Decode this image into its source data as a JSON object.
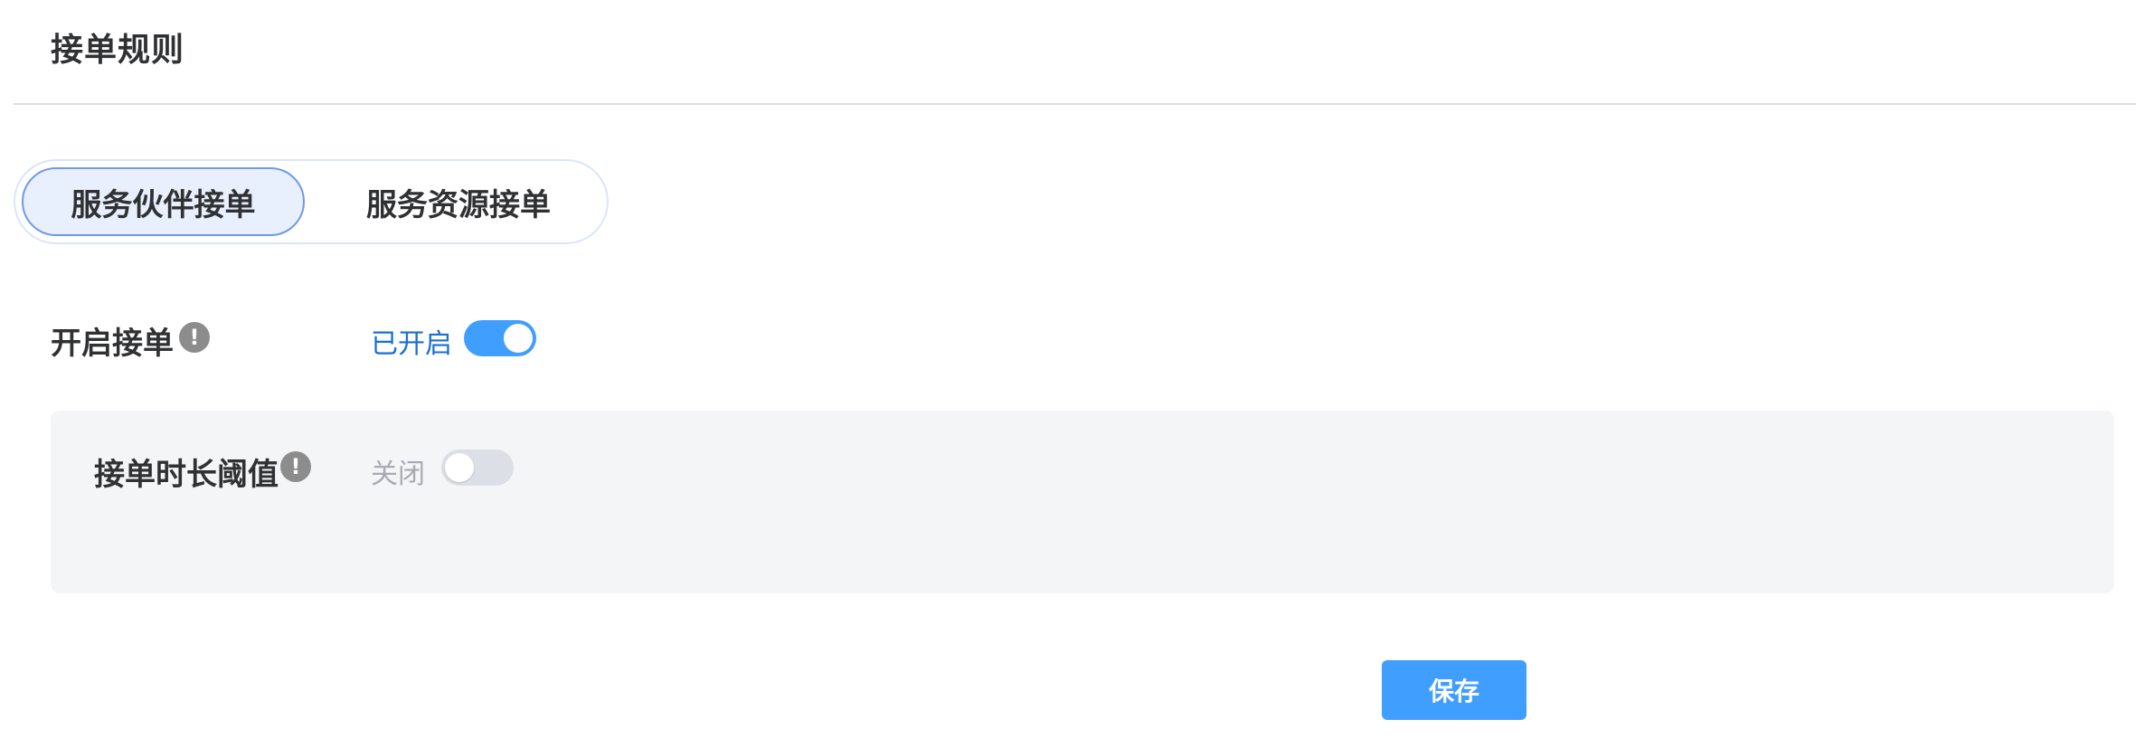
{
  "page": {
    "title": "接单规则"
  },
  "tabs": [
    {
      "label": "服务伙伴接单",
      "active": true
    },
    {
      "label": "服务资源接单",
      "active": false
    }
  ],
  "order_switch": {
    "label": "开启接单",
    "info_icon": "exclamation-circle-icon",
    "status_text": "已开启",
    "enabled": true,
    "status_color": "#1a6fd1"
  },
  "duration_threshold": {
    "label": "接单时长阈值",
    "info_icon": "exclamation-circle-icon",
    "status_text": "关闭",
    "enabled": false,
    "status_color": "#a8abb2"
  },
  "actions": {
    "save_label": "保存"
  },
  "colors": {
    "primary": "#409eff",
    "tab_active_bg": "#e8effd",
    "tab_active_border": "#6f99e8",
    "panel_bg": "#f4f5f7"
  }
}
